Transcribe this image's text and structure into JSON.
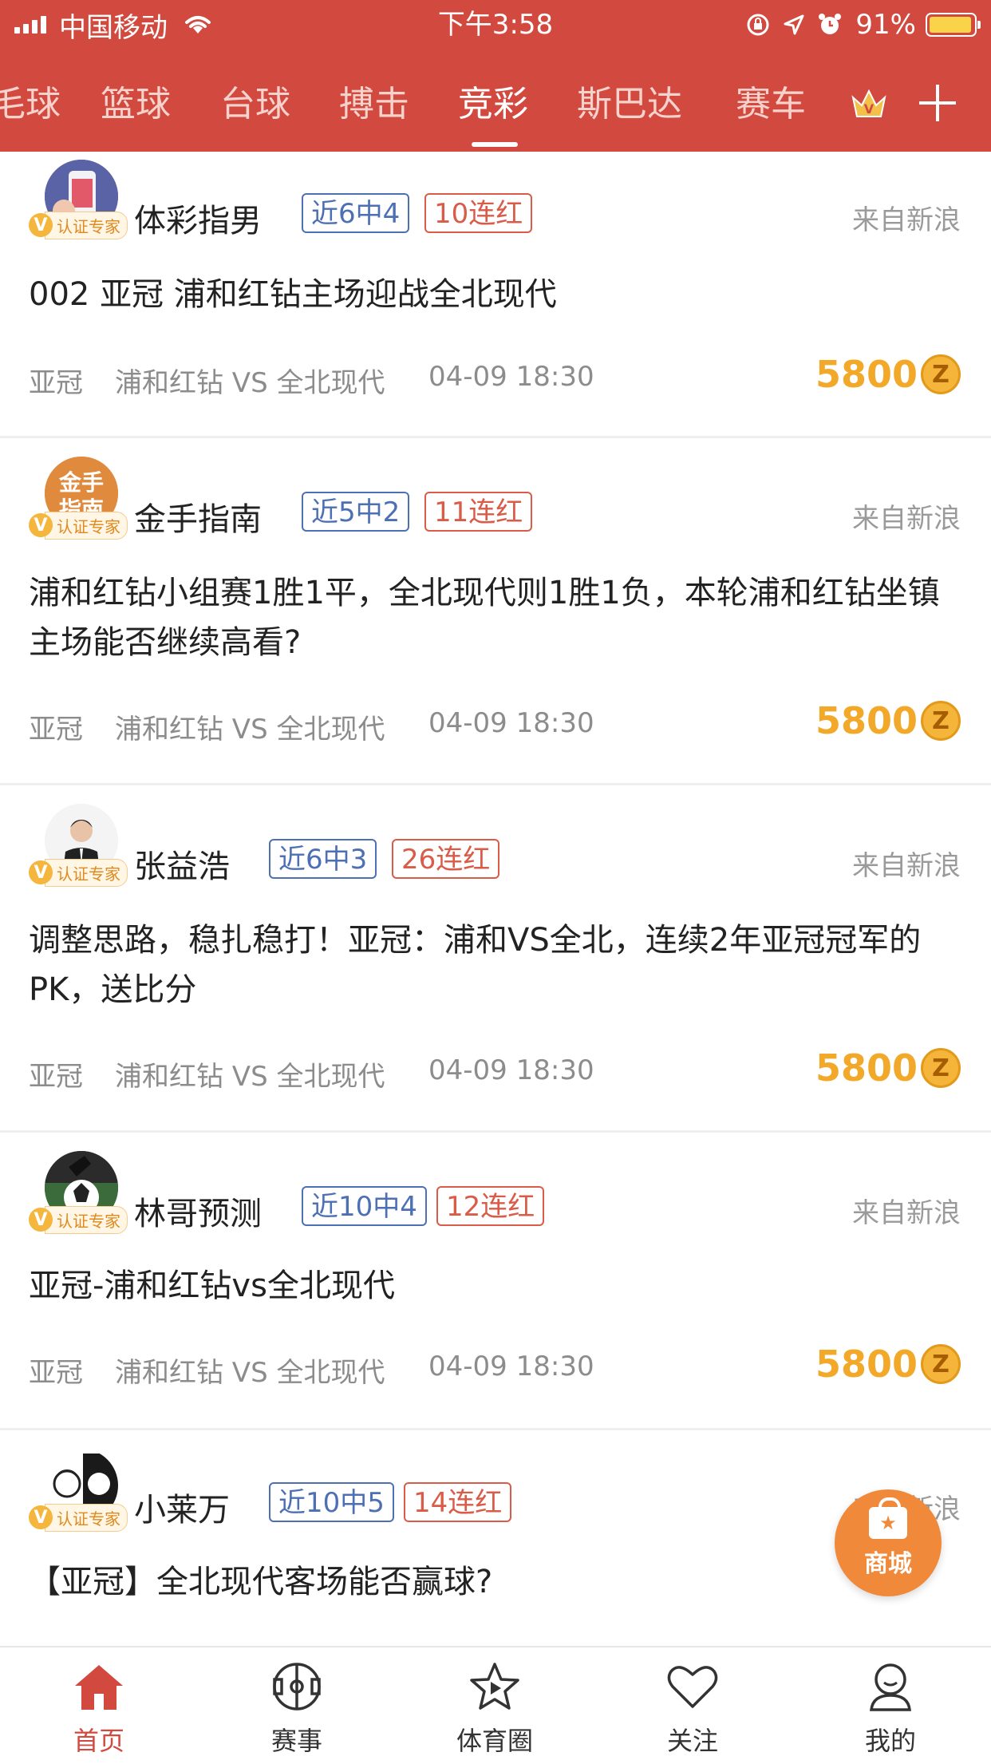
{
  "status_bar": {
    "carrier": "中国移动",
    "time": "下午3:58",
    "battery": "91%"
  },
  "tabs": [
    {
      "label": "毛球",
      "active": false
    },
    {
      "label": "篮球",
      "active": false
    },
    {
      "label": "台球",
      "active": false
    },
    {
      "label": "搏击",
      "active": false
    },
    {
      "label": "竞彩",
      "active": true
    },
    {
      "label": "斯巴达",
      "active": false
    },
    {
      "label": "赛车",
      "active": false
    }
  ],
  "feed": {
    "cert_v": "V",
    "cert_label": "认证专家",
    "coin_symbol": "Z",
    "items": [
      {
        "author": "体彩指男",
        "record": "近6中4",
        "streak": "10连红",
        "source": "来自新浪",
        "title": "002 亚冠 浦和红钻主场迎战全北现代",
        "league": "亚冠",
        "match": "浦和红钻 VS 全北现代",
        "datetime": "04-09 18:30",
        "price": "5800"
      },
      {
        "author": "金手指南",
        "record": "近5中2",
        "streak": "11连红",
        "source": "来自新浪",
        "title": "浦和红钻小组赛1胜1平，全北现代则1胜1负，本轮浦和红钻坐镇主场能否继续高看?",
        "league": "亚冠",
        "match": "浦和红钻 VS 全北现代",
        "datetime": "04-09 18:30",
        "price": "5800"
      },
      {
        "author": "张益浩",
        "record": "近6中3",
        "streak": "26连红",
        "source": "来自新浪",
        "title": "调整思路，稳扎稳打！亚冠：浦和VS全北，连续2年亚冠冠军的PK，送比分",
        "league": "亚冠",
        "match": "浦和红钻 VS 全北现代",
        "datetime": "04-09 18:30",
        "price": "5800"
      },
      {
        "author": "林哥预测",
        "record": "近10中4",
        "streak": "12连红",
        "source": "来自新浪",
        "title": "亚冠-浦和红钻vs全北现代",
        "league": "亚冠",
        "match": "浦和红钻 VS 全北现代",
        "datetime": "04-09 18:30",
        "price": "5800"
      },
      {
        "author": "小莱万",
        "record": "近10中5",
        "streak": "14连红",
        "source": "来自新浪",
        "title": "【亚冠】全北现代客场能否赢球?"
      }
    ]
  },
  "mall_button": {
    "label": "商城"
  },
  "bottom_nav": [
    {
      "label": "首页",
      "icon": "home-icon",
      "active": true
    },
    {
      "label": "赛事",
      "icon": "pitch-icon",
      "active": false
    },
    {
      "label": "体育圈",
      "icon": "star-play-icon",
      "active": false
    },
    {
      "label": "关注",
      "icon": "heart-icon",
      "active": false
    },
    {
      "label": "我的",
      "icon": "user-icon",
      "active": false
    }
  ],
  "colors": {
    "brand_red": "#d24a3f",
    "record_blue": "#4d6fb4",
    "streak_red": "#d95b48",
    "price_gold": "#f2a92a"
  }
}
